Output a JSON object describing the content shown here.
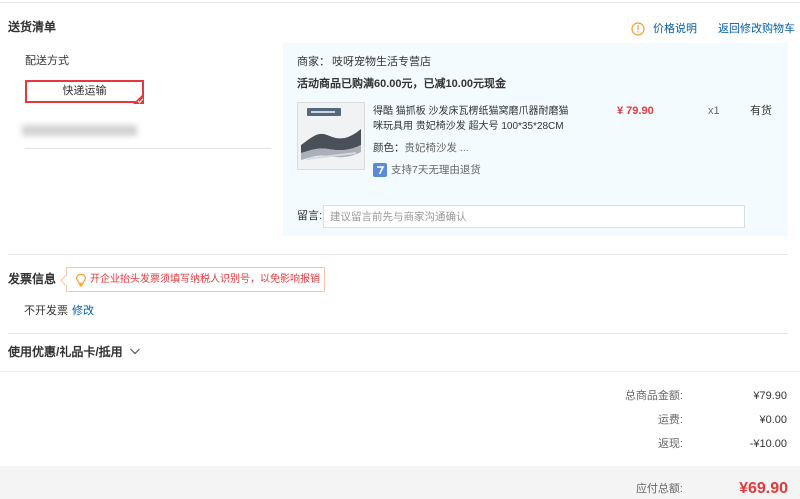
{
  "header": {
    "title": "送货清单",
    "price_note": "价格说明",
    "back_to_cart": "返回修改购物车"
  },
  "shipping": {
    "label": "配送方式",
    "method": "快递运输"
  },
  "shop": {
    "merchant_label": "商家：",
    "merchant_name": "吱呀宠物生活专营店",
    "promo": "活动商品已购满60.00元，已减10.00元现金",
    "item": {
      "title": "得酷 猫抓板 沙发床瓦楞纸猫窝磨爪器耐磨猫咪玩具用 贵妃椅沙发 超大号 100*35*28CM",
      "color_label": "颜色：",
      "color_value": "贵妃椅沙发 ...",
      "return_policy": "支持7天无理由退货",
      "price": "¥ 79.90",
      "quantity": "x1",
      "stock": "有货"
    },
    "note_label": "留言:",
    "note_placeholder": "建议留言前先与商家沟通确认"
  },
  "invoice": {
    "title": "发票信息",
    "tip": "开企业抬头发票须填写纳税人识别号，以免影响报销",
    "value": "不开发票",
    "edit_link": "修改"
  },
  "coupon": {
    "title": "使用优惠/礼品卡/抵用"
  },
  "summary": {
    "rows": [
      {
        "label": "总商品金额:",
        "value": "¥79.90"
      },
      {
        "label": "运费:",
        "value": "¥0.00"
      },
      {
        "label": "返现:",
        "value": "-¥10.00"
      }
    ],
    "total_label": "应付总额:",
    "total_value": "¥69.90"
  },
  "icons": {
    "price_note": "warning-circle-icon",
    "selected_corner": "check-corner-icon",
    "return_policy": "seven-day-return-icon",
    "invoice_tip": "lightbulb-icon",
    "coupon_toggle": "chevron-down-icon"
  },
  "colors": {
    "accent_red": "#e4393c",
    "link_blue": "#005ea7",
    "shop_panel_bg": "#f3fbfe",
    "warning_orange": "#f59a23",
    "total_bar_bg": "#f4f4f4"
  }
}
